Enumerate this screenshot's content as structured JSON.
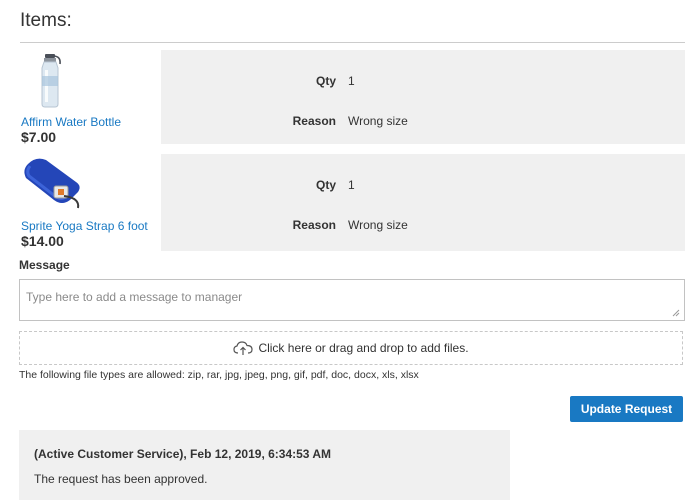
{
  "items_section": {
    "title": "Items:"
  },
  "items": [
    {
      "name": "Affirm Water Bottle",
      "price": "$7.00",
      "thumbnail_icon": "water-bottle-icon",
      "qty_label": "Qty",
      "qty_value": "1",
      "reason_label": "Reason",
      "reason_value": "Wrong size"
    },
    {
      "name": "Sprite Yoga Strap 6 foot",
      "price": "$14.00",
      "thumbnail_icon": "yoga-strap-icon",
      "qty_label": "Qty",
      "qty_value": "1",
      "reason_label": "Reason",
      "reason_value": "Wrong size"
    }
  ],
  "message": {
    "label": "Message",
    "value": "",
    "placeholder": "Type here to add a message to manager"
  },
  "upload": {
    "icon": "cloud-upload-icon",
    "text": "Click here or drag and drop to add files.",
    "allowed_types": "The following file types are allowed: zip, rar, jpg, jpeg, png, gif, pdf, doc, docx, xls, xlsx"
  },
  "actions": {
    "update_label": "Update Request"
  },
  "history": [
    {
      "header": "(Active Customer Service), Feb 12, 2019, 6:34:53 AM",
      "text": "The request has been approved."
    }
  ],
  "colors": {
    "link": "#1979c3",
    "button_bg": "#1979c3",
    "panel_bg": "#f0f0f0"
  }
}
